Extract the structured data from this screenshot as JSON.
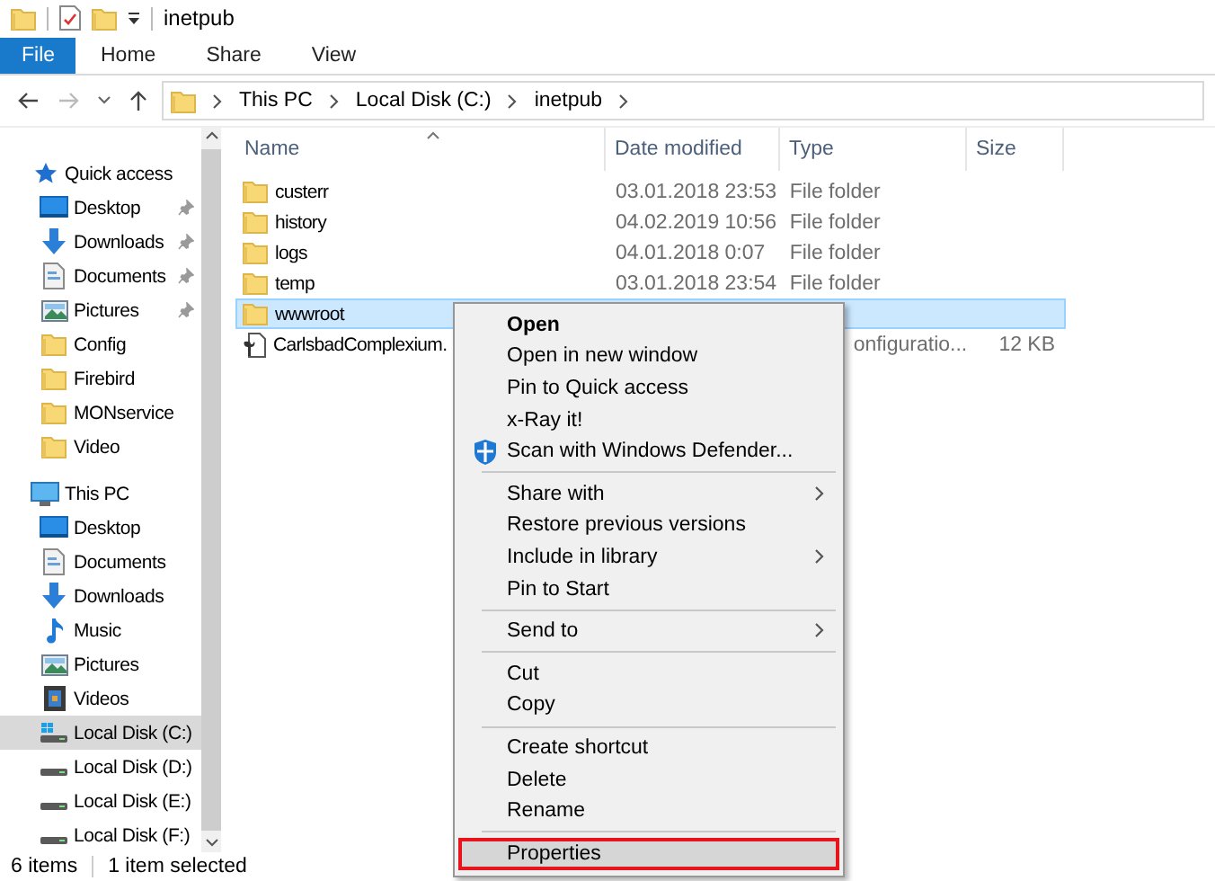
{
  "title_bar": {
    "title": "inetpub"
  },
  "ribbon_tabs": [
    {
      "label": "File",
      "kind": "file",
      "selected": false
    },
    {
      "label": "Home",
      "kind": "tab",
      "selected": false
    },
    {
      "label": "Share",
      "kind": "tab",
      "selected": false
    },
    {
      "label": "View",
      "kind": "tab",
      "selected": false
    }
  ],
  "address_bar": {
    "path": [
      "This PC",
      "Local Disk (C:)",
      "inetpub"
    ]
  },
  "sidebar": {
    "items": [
      {
        "label": "Quick access",
        "kind": "star",
        "selected": false,
        "children": [
          {
            "label": "Desktop",
            "kind": "desktop",
            "selected": false,
            "pinned": true
          },
          {
            "label": "Downloads",
            "kind": "downloads",
            "selected": false,
            "pinned": true
          },
          {
            "label": "Documents",
            "kind": "documents",
            "selected": false,
            "pinned": true
          },
          {
            "label": "Pictures",
            "kind": "pictures",
            "selected": false,
            "pinned": true
          },
          {
            "label": "Config",
            "kind": "folder",
            "selected": false,
            "pinned": false
          },
          {
            "label": "Firebird",
            "kind": "folder",
            "selected": false,
            "pinned": false
          },
          {
            "label": "MONservice",
            "kind": "folder",
            "selected": false,
            "pinned": false
          },
          {
            "label": "Video",
            "kind": "folder",
            "selected": false,
            "pinned": false
          }
        ]
      },
      {
        "label": "This PC",
        "kind": "pc",
        "selected": false,
        "children": [
          {
            "label": "Desktop",
            "kind": "desktop",
            "selected": false,
            "pinned": false
          },
          {
            "label": "Documents",
            "kind": "documents",
            "selected": false,
            "pinned": false
          },
          {
            "label": "Downloads",
            "kind": "downloads",
            "selected": false,
            "pinned": false
          },
          {
            "label": "Music",
            "kind": "music",
            "selected": false,
            "pinned": false
          },
          {
            "label": "Pictures",
            "kind": "pictures",
            "selected": false,
            "pinned": false
          },
          {
            "label": "Videos",
            "kind": "videos",
            "selected": false,
            "pinned": false
          },
          {
            "label": "Local Disk (C:)",
            "kind": "system-drive",
            "selected": true,
            "pinned": false
          },
          {
            "label": "Local Disk (D:)",
            "kind": "drive",
            "selected": false,
            "pinned": false
          },
          {
            "label": "Local Disk (E:)",
            "kind": "drive",
            "selected": false,
            "pinned": false
          },
          {
            "label": "Local Disk (F:)",
            "kind": "drive",
            "selected": false,
            "pinned": false
          }
        ]
      }
    ]
  },
  "file_list": {
    "columns": [
      "Name",
      "Date modified",
      "Type",
      "Size"
    ],
    "rows": [
      {
        "name": "custerr",
        "date": "03.01.2018 23:53",
        "type": "File folder",
        "size": "",
        "kind": "folder",
        "selected": false
      },
      {
        "name": "history",
        "date": "04.02.2019 10:56",
        "type": "File folder",
        "size": "",
        "kind": "folder",
        "selected": false
      },
      {
        "name": "logs",
        "date": "04.01.2018 0:07",
        "type": "File folder",
        "size": "",
        "kind": "folder",
        "selected": false
      },
      {
        "name": "temp",
        "date": "03.01.2018 23:54",
        "type": "File folder",
        "size": "",
        "kind": "folder",
        "selected": false
      },
      {
        "name": "wwwroot",
        "date": "",
        "type": "",
        "size": "",
        "kind": "folder",
        "selected": true
      },
      {
        "name": "CarlsbadComplexium.",
        "date": "",
        "type": "onfiguratio...",
        "size": "12 KB",
        "kind": "config",
        "selected": false
      }
    ]
  },
  "context_menu": {
    "items": [
      {
        "kind": "item",
        "label": "Open",
        "bold": true,
        "submenu": false,
        "selected": false
      },
      {
        "kind": "item",
        "label": "Open in new window",
        "bold": false,
        "submenu": false,
        "selected": false
      },
      {
        "kind": "item",
        "label": "Pin to Quick access",
        "bold": false,
        "submenu": false,
        "selected": false
      },
      {
        "kind": "item",
        "label": "x-Ray it!",
        "bold": false,
        "submenu": false,
        "selected": false
      },
      {
        "kind": "scan",
        "label": "Scan with Windows Defender...",
        "bold": false,
        "submenu": false,
        "selected": false
      },
      {
        "kind": "separator"
      },
      {
        "kind": "item",
        "label": "Share with",
        "bold": false,
        "submenu": true,
        "selected": false
      },
      {
        "kind": "item",
        "label": "Restore previous versions",
        "bold": false,
        "submenu": false,
        "selected": false
      },
      {
        "kind": "item",
        "label": "Include in library",
        "bold": false,
        "submenu": true,
        "selected": false
      },
      {
        "kind": "item",
        "label": "Pin to Start",
        "bold": false,
        "submenu": false,
        "selected": false
      },
      {
        "kind": "separator"
      },
      {
        "kind": "item",
        "label": "Send to",
        "bold": false,
        "submenu": true,
        "selected": false
      },
      {
        "kind": "separator"
      },
      {
        "kind": "item",
        "label": "Cut",
        "bold": false,
        "submenu": false,
        "selected": false
      },
      {
        "kind": "item",
        "label": "Copy",
        "bold": false,
        "submenu": false,
        "selected": false
      },
      {
        "kind": "separator"
      },
      {
        "kind": "item",
        "label": "Create shortcut",
        "bold": false,
        "submenu": false,
        "selected": false
      },
      {
        "kind": "item",
        "label": "Delete",
        "bold": false,
        "submenu": false,
        "selected": false
      },
      {
        "kind": "item",
        "label": "Rename",
        "bold": false,
        "submenu": false,
        "selected": false
      },
      {
        "kind": "separator"
      },
      {
        "kind": "item",
        "label": "Properties",
        "bold": false,
        "submenu": false,
        "selected": true
      }
    ]
  },
  "status_bar": {
    "count": "6 items",
    "selection": "1 item selected"
  }
}
